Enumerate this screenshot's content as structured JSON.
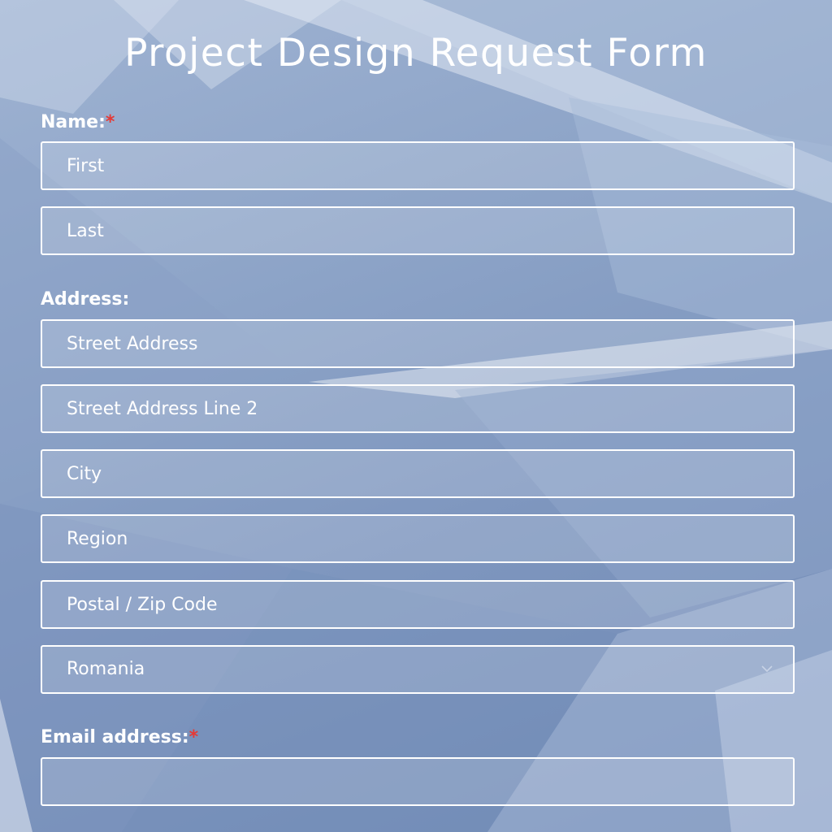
{
  "form": {
    "title": "Project Design Request Form",
    "name": {
      "label": "Name:",
      "required_mark": "*",
      "first_placeholder": "First",
      "last_placeholder": "Last"
    },
    "address": {
      "label": "Address:",
      "street_placeholder": "Street Address",
      "street2_placeholder": "Street Address Line 2",
      "city_placeholder": "City",
      "region_placeholder": "Region",
      "postal_placeholder": "Postal / Zip Code",
      "country_selected": "Romania"
    },
    "email": {
      "label": "Email address:",
      "required_mark": "*",
      "value": ""
    }
  },
  "icons": {
    "country_dropdown": "chevron-down-icon"
  },
  "colors": {
    "text": "#ffffff",
    "required": "#e53935",
    "field_border": "#ffffff"
  }
}
